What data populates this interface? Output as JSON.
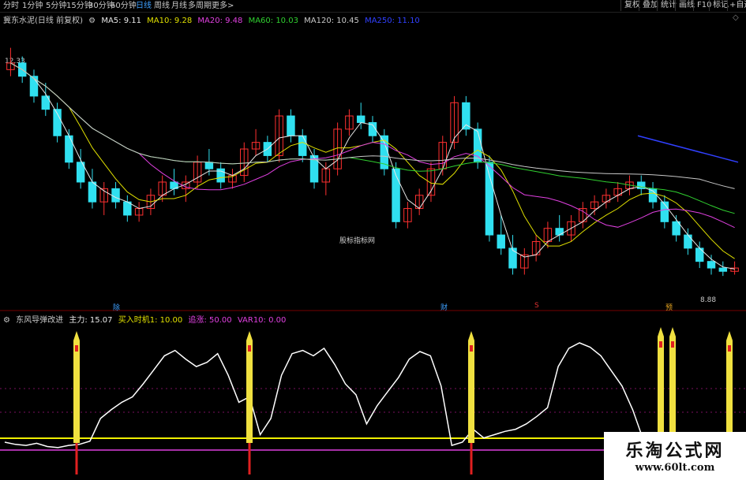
{
  "toolbar": {
    "periods": [
      "分时",
      "1分钟",
      "5分钟",
      "15分钟",
      "30分钟",
      "60分钟",
      "日线",
      "周线",
      "月线",
      "多周期",
      "更多>"
    ],
    "active_period": "日线",
    "right_buttons": [
      "复权",
      "叠加",
      "统计",
      "画线",
      "F10",
      "标记",
      "+自选"
    ]
  },
  "legend": {
    "stock": "冀东水泥(日线 前复权)",
    "ma5": "MA5: 9.11",
    "ma10": "MA10: 9.28",
    "ma20": "MA20: 9.48",
    "ma60": "MA60: 10.03",
    "ma120": "MA120: 10.45",
    "ma250": "MA250: 11.10"
  },
  "indicator_legend": {
    "name": "东风导弹改进",
    "main": "主力: 15.07",
    "buy": "买入时机1: 10.00",
    "chase": "追涨: 50.00",
    "var10": "VAR10: 0.00"
  },
  "price_labels": {
    "high": "12.33",
    "low": "8.88"
  },
  "watermark": "股标指标网",
  "markers": [
    {
      "text": "除",
      "color": "#3ea0ff"
    },
    {
      "text": "财",
      "color": "#3ea0ff"
    },
    {
      "text": "S",
      "color": "#e03030"
    },
    {
      "text": "预",
      "color": "#e0a020"
    }
  ],
  "logo": {
    "title": "乐淘公式网",
    "url": "www.60lt.com"
  },
  "colors": {
    "up": "#ff3030",
    "down": "#30e0f0",
    "ma5": "#e8e8e8",
    "ma10": "#e0e000",
    "ma20": "#e040e0",
    "ma60": "#30d030",
    "ma120": "#c8c8c8",
    "ma250": "#3040ff",
    "rocket": "#f0e040"
  },
  "chart_data": {
    "type": "candlestick",
    "ylim": [
      8.5,
      12.6
    ],
    "candles": [
      [
        12.0,
        12.33,
        11.9,
        12.1
      ],
      [
        12.1,
        12.2,
        11.8,
        11.9
      ],
      [
        11.9,
        12.0,
        11.5,
        11.6
      ],
      [
        11.6,
        11.8,
        11.3,
        11.4
      ],
      [
        11.4,
        11.5,
        10.9,
        11.0
      ],
      [
        11.0,
        11.1,
        10.5,
        10.6
      ],
      [
        10.6,
        10.8,
        10.2,
        10.3
      ],
      [
        10.3,
        10.5,
        9.9,
        10.0
      ],
      [
        10.0,
        10.3,
        9.8,
        10.2
      ],
      [
        10.2,
        10.3,
        9.9,
        10.0
      ],
      [
        10.0,
        10.1,
        9.7,
        9.8
      ],
      [
        9.8,
        10.0,
        9.7,
        9.9
      ],
      [
        9.9,
        10.2,
        9.8,
        10.1
      ],
      [
        10.1,
        10.4,
        10.0,
        10.3
      ],
      [
        10.3,
        10.5,
        10.1,
        10.2
      ],
      [
        10.2,
        10.4,
        10.0,
        10.3
      ],
      [
        10.3,
        10.7,
        10.2,
        10.6
      ],
      [
        10.6,
        10.8,
        10.4,
        10.5
      ],
      [
        10.5,
        10.6,
        10.2,
        10.3
      ],
      [
        10.3,
        10.5,
        10.2,
        10.4
      ],
      [
        10.4,
        10.9,
        10.3,
        10.8
      ],
      [
        10.8,
        11.1,
        10.7,
        10.9
      ],
      [
        10.9,
        11.0,
        10.6,
        10.7
      ],
      [
        10.7,
        11.4,
        10.6,
        11.3
      ],
      [
        11.3,
        11.4,
        10.9,
        11.0
      ],
      [
        11.0,
        11.1,
        10.6,
        10.7
      ],
      [
        10.7,
        10.8,
        10.2,
        10.3
      ],
      [
        10.3,
        10.6,
        10.1,
        10.5
      ],
      [
        10.5,
        11.2,
        10.4,
        11.1
      ],
      [
        11.1,
        11.4,
        11.0,
        11.3
      ],
      [
        11.3,
        11.5,
        11.1,
        11.2
      ],
      [
        11.2,
        11.3,
        10.9,
        11.0
      ],
      [
        11.0,
        11.1,
        10.4,
        10.5
      ],
      [
        10.5,
        10.6,
        9.6,
        9.7
      ],
      [
        9.7,
        10.0,
        9.6,
        9.9
      ],
      [
        9.9,
        10.2,
        9.8,
        10.1
      ],
      [
        10.1,
        10.6,
        10.0,
        10.5
      ],
      [
        10.5,
        11.0,
        10.4,
        10.9
      ],
      [
        10.9,
        11.6,
        10.8,
        11.5
      ],
      [
        11.5,
        11.6,
        11.0,
        11.1
      ],
      [
        11.1,
        11.2,
        10.5,
        10.6
      ],
      [
        10.6,
        10.7,
        9.4,
        9.5
      ],
      [
        9.5,
        9.8,
        9.2,
        9.3
      ],
      [
        9.3,
        9.5,
        8.9,
        9.0
      ],
      [
        9.0,
        9.3,
        8.9,
        9.2
      ],
      [
        9.2,
        9.5,
        9.1,
        9.4
      ],
      [
        9.4,
        9.7,
        9.3,
        9.6
      ],
      [
        9.6,
        9.8,
        9.4,
        9.5
      ],
      [
        9.5,
        9.8,
        9.4,
        9.7
      ],
      [
        9.7,
        10.0,
        9.6,
        9.9
      ],
      [
        9.9,
        10.1,
        9.8,
        10.0
      ],
      [
        10.0,
        10.2,
        9.9,
        10.1
      ],
      [
        10.1,
        10.3,
        10.0,
        10.2
      ],
      [
        10.2,
        10.4,
        10.1,
        10.3
      ],
      [
        10.3,
        10.4,
        10.1,
        10.2
      ],
      [
        10.2,
        10.3,
        9.9,
        10.0
      ],
      [
        10.0,
        10.1,
        9.6,
        9.7
      ],
      [
        9.7,
        9.8,
        9.4,
        9.5
      ],
      [
        9.5,
        9.6,
        9.2,
        9.3
      ],
      [
        9.3,
        9.4,
        9.0,
        9.1
      ],
      [
        9.1,
        9.2,
        8.9,
        9.0
      ],
      [
        9.0,
        9.1,
        8.88,
        8.95
      ],
      [
        8.95,
        9.1,
        8.9,
        9.0
      ]
    ],
    "main_series": [
      0.08,
      0.06,
      0.05,
      0.07,
      0.04,
      0.03,
      0.05,
      0.06,
      0.09,
      0.3,
      0.38,
      0.45,
      0.5,
      0.62,
      0.75,
      0.88,
      0.93,
      0.85,
      0.78,
      0.82,
      0.9,
      0.7,
      0.45,
      0.5,
      0.15,
      0.3,
      0.7,
      0.9,
      0.93,
      0.88,
      0.95,
      0.8,
      0.62,
      0.52,
      0.25,
      0.42,
      0.55,
      0.68,
      0.85,
      0.92,
      0.88,
      0.6,
      0.05,
      0.08,
      0.2,
      0.12,
      0.15,
      0.18,
      0.2,
      0.25,
      0.32,
      0.4,
      0.78,
      0.95,
      1.0,
      0.96,
      0.88,
      0.74,
      0.6,
      0.38,
      0.1
    ]
  }
}
